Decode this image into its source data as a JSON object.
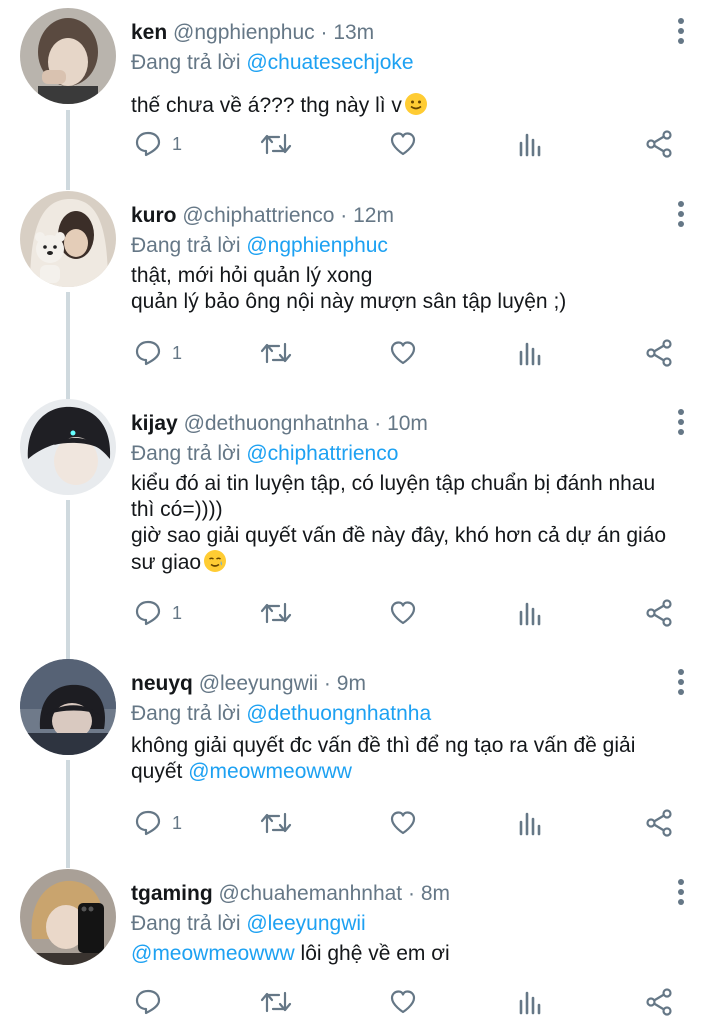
{
  "reply_prefix": "Đang trả lời",
  "colors": {
    "text": "#14171a",
    "muted": "#657786",
    "link": "#1da1f2",
    "thread_line": "#cfd9de"
  },
  "tweets": [
    {
      "name": "ken",
      "handle": "@ngphienphuc",
      "separator": "·",
      "time": "13m",
      "reply_to": "@chuatesechjoke",
      "lines": [
        "thế chưa về á??? thg này lì v"
      ],
      "line_emoji": "slightly-smiling-face",
      "reply_count": "1"
    },
    {
      "name": "kuro",
      "handle": "@chiphattrienco",
      "separator": "·",
      "time": "12m",
      "reply_to": "@ngphienphuc",
      "lines": [
        "thật, mới hỏi quản lý xong",
        "quản lý bảo ông nội này mượn sân tập luyện ;)"
      ],
      "reply_count": "1"
    },
    {
      "name": "kijay",
      "handle": "@dethuongnhatnha",
      "separator": "·",
      "time": "10m",
      "reply_to": "@chiphattrienco",
      "lines": [
        "kiểu đó ai tin luyện tập, có luyện tập chuẩn bị đánh nhau",
        "thì có=))))",
        "giờ sao giải quyết vấn đề này đây, khó hơn cả dự án giáo",
        "sư giao"
      ],
      "line_emoji": "smiling-face-with-tear",
      "reply_count": "1"
    },
    {
      "name": "neuyq",
      "handle": "@leeyungwii",
      "separator": "·",
      "time": "9m",
      "reply_to": "@dethuongnhatnha",
      "lines": [
        "không giải quyết đc vấn đề thì để ng tạo ra vấn đề giải",
        "quyết "
      ],
      "mention": "@meowmeowww",
      "reply_count": "1"
    },
    {
      "name": "tgaming",
      "handle": "@chuahemanhnhat",
      "separator": "·",
      "time": "8m",
      "reply_to": "@leeyungwii",
      "mention": "@meowmeowww",
      "lines": [
        " lôi ghệ về em ơi"
      ],
      "reply_count": ""
    }
  ]
}
